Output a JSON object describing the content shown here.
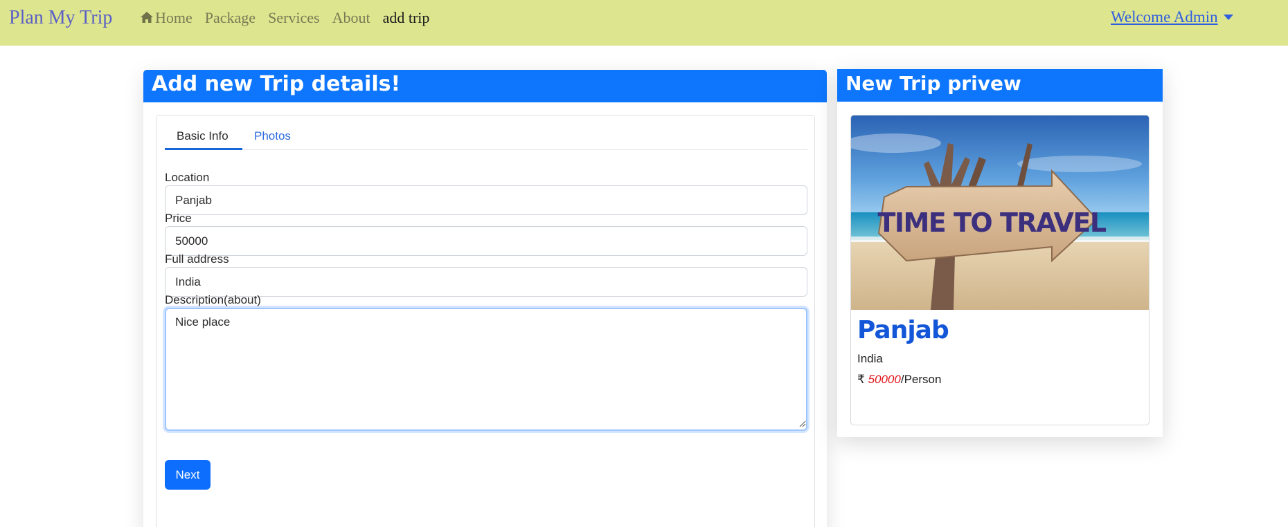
{
  "navbar": {
    "brand": "Plan My Trip",
    "links": [
      "Home",
      "Package",
      "Services",
      "About",
      "add trip"
    ],
    "user": "Welcome Admin"
  },
  "form": {
    "header": "Add new Trip details!",
    "tabs": [
      "Basic Info",
      "Photos"
    ],
    "location_label": "Location",
    "location_value": "Panjab",
    "price_label": "Price",
    "price_value": "50000",
    "address_label": "Full address",
    "address_value": "India",
    "description_label": "Description(about)",
    "description_value": "Nice place",
    "next_label": "Next"
  },
  "preview": {
    "header": "New Trip privew",
    "image_sign_text": "TIME TO TRAVEL",
    "title": "Panjab",
    "address": "India",
    "currency": "₹",
    "price": "50000",
    "per_unit": "/Person"
  },
  "colors": {
    "navbar_bg": "#dde58f",
    "header_blue": "#0d76fc",
    "primary": "#0d6efd",
    "price_red": "#e0151b"
  }
}
